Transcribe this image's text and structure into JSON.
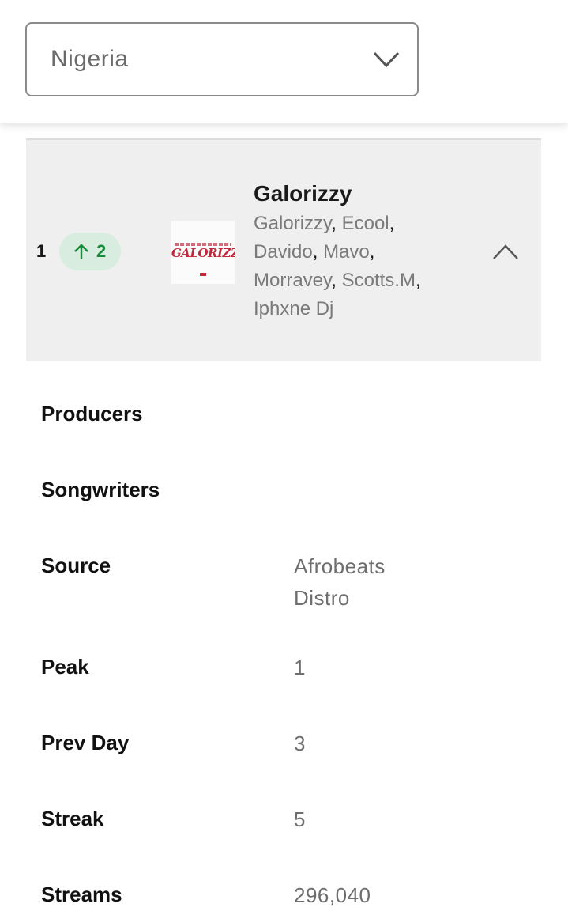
{
  "country_select": {
    "value": "Nigeria",
    "icon": "chevron-down-icon"
  },
  "entry": {
    "rank": "1",
    "movement": {
      "direction": "up",
      "value": "2",
      "color": "#1a8a3c",
      "icon": "arrow-up-icon"
    },
    "cover_text": "GALORIZZY",
    "title": "Galorizzy",
    "artists": [
      "Galorizzy",
      "Ecool",
      "Davido",
      "Mavo",
      "Morravey",
      "Scotts.M",
      "Iphxne Dj"
    ],
    "collapse_icon": "chevron-up-icon"
  },
  "details": {
    "producers_label": "Producers",
    "songwriters_label": "Songwriters",
    "source_label": "Source",
    "source_value_line1": "Afrobeats",
    "source_value_line2": "Distro",
    "peak_label": "Peak",
    "peak_value": "1",
    "prev_day_label": "Prev Day",
    "prev_day_value": "3",
    "streak_label": "Streak",
    "streak_value": "5",
    "streams_label": "Streams",
    "streams_value": "296,040"
  }
}
